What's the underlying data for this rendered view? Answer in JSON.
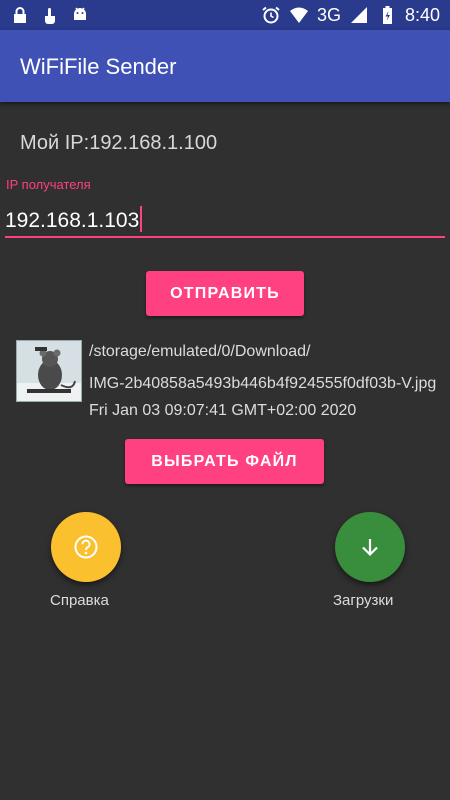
{
  "status_bar": {
    "icons_left": [
      "lock-icon",
      "touch-icon",
      "android-icon"
    ],
    "icons_right": [
      "alarm-icon",
      "wifi-icon",
      "signal-icon",
      "battery-icon"
    ],
    "network": "3G",
    "time": "8:40"
  },
  "app_bar": {
    "title": "WiFiFile Sender"
  },
  "main": {
    "my_ip": "Мой IP:192.168.1.100",
    "recipient_ip": {
      "label": "IP получателя",
      "value": "192.168.1.103"
    },
    "send_button": "ОТПРАВИТЬ",
    "file": {
      "path": "/storage/emulated/0/Download/",
      "name": "IMG-2b40858a5493b446b4f924555f0df03b-V.jpg",
      "date": "Fri Jan 03 09:07:41 GMT+02:00 2020"
    },
    "pick_file_button": "ВЫБРАТЬ ФАЙЛ",
    "help": {
      "label": "Справка",
      "color": "#fbc02d",
      "icon": "help-icon"
    },
    "downloads": {
      "label": "Загрузки",
      "color": "#388e3c",
      "icon": "download-arrow-icon"
    }
  },
  "colors": {
    "accent": "#ff4081",
    "primary": "#3f51b5",
    "primary_dark": "#2a3a8c",
    "background": "#303030"
  }
}
